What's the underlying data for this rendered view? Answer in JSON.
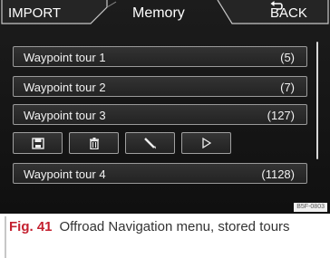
{
  "screen": {
    "tabs": {
      "import": "IMPORT",
      "title": "Memory",
      "back": "BACK",
      "back_icon": "return-arrow-icon"
    },
    "tours": [
      {
        "name": "Waypoint tour 1",
        "count": "(5)"
      },
      {
        "name": "Waypoint tour 2",
        "count": "(7)"
      },
      {
        "name": "Waypoint tour 3",
        "count": "(127)"
      },
      {
        "name": "Waypoint tour 4",
        "count": "(1128)"
      }
    ],
    "actions": [
      {
        "icon": "save-icon"
      },
      {
        "icon": "delete-icon"
      },
      {
        "icon": "edit-icon"
      },
      {
        "icon": "play-icon"
      }
    ],
    "image_code": "B5F-0803"
  },
  "caption": {
    "figure_label": "Fig. 41",
    "text": "Offroad Navigation menu, stored tours"
  },
  "colors": {
    "screen_background": "#151515",
    "button_border": "#9a9a9a",
    "text": "#ffffff",
    "figure_label": "#c4202f"
  }
}
